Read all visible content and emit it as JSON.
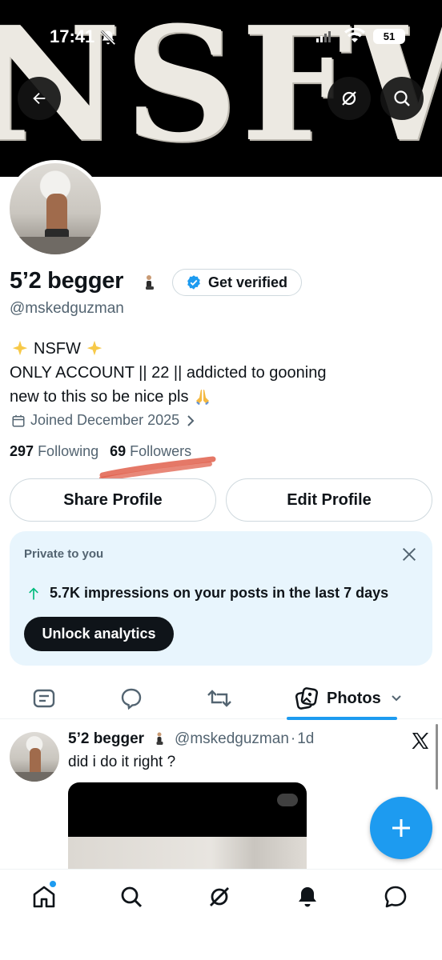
{
  "status_bar": {
    "time": "17:41",
    "battery": "51"
  },
  "banner": {
    "text": "NSFW"
  },
  "profile": {
    "display_name": "5’2 begger",
    "verify_label": "Get verified",
    "handle": "@mskedguzman",
    "bio": {
      "line1": "NSFW",
      "line2": "ONLY ACCOUNT || 22 || addicted to gooning",
      "line3": "new to this so be nice pls"
    },
    "joined": "Joined December 2025",
    "following_count": "297",
    "following_label": "Following",
    "followers_count": "69",
    "followers_label": "Followers"
  },
  "actions": {
    "share": "Share Profile",
    "edit": "Edit Profile"
  },
  "analytics_card": {
    "kicker": "Private to you",
    "stat": "5.7K impressions on your posts in the last 7 days",
    "cta": "Unlock analytics"
  },
  "tabs": {
    "active_label": "Photos"
  },
  "post": {
    "author": "5’2 begger",
    "handle": "@mskedguzman",
    "separator": "·",
    "age": "1d",
    "text": "did i do it right ?"
  },
  "icons": {
    "back": "arrow-left-icon",
    "grok": "grok-icon",
    "search": "search-icon",
    "verified": "verified-badge-icon",
    "calendar": "calendar-icon",
    "close": "close-icon",
    "arrow_up": "arrow-up-icon",
    "fab": "plus-icon",
    "nav": [
      "home-icon",
      "search-icon",
      "grok-icon",
      "bell-icon",
      "chat-icon"
    ]
  },
  "colors": {
    "accent": "#1d9bf0",
    "muted": "#536471",
    "card_bg": "#e8f5fd",
    "up_arrow": "#00ba7c"
  }
}
